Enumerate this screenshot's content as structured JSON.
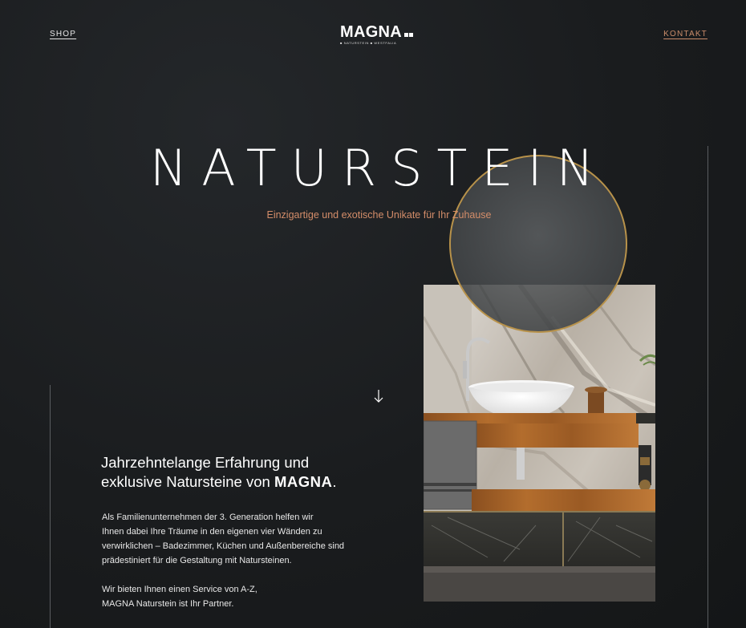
{
  "nav": {
    "shop_label": "SHOP",
    "contact_label": "KONTAKT"
  },
  "logo": {
    "wordmark": "MAGNA",
    "tagline": "■ NATURSTEIN ■ WESTFALIA"
  },
  "hero": {
    "title": "NATURSTEIN",
    "subtitle": "Einzigartige und exotische Unikate für Ihr Zuhause",
    "scroll_icon": "arrow-down-icon"
  },
  "intro": {
    "headline_line1": "Jahrzehntelange Erfahrung und",
    "headline_line2_pre": "exklusive Natursteine von ",
    "headline_brand": "MAGNA",
    "headline_line2_post": ".",
    "paragraph1_lines": [
      "Als Familienunternehmen der 3. Generation helfen wir",
      "Ihnen dabei Ihre Träume in den eigenen vier Wänden zu",
      "verwirklichen – Badezimmer, Küchen und Außenbereiche sind",
      "prädestiniert für die Gestaltung mit Natursteinen."
    ],
    "paragraph2_lines": [
      "Wir bieten Ihnen einen Service von A-Z,",
      "MAGNA Naturstein ist Ihr Partner."
    ]
  },
  "colors": {
    "background": "#1b1d1f",
    "accent": "#d48d69",
    "mirror_frame": "#b8924a"
  }
}
